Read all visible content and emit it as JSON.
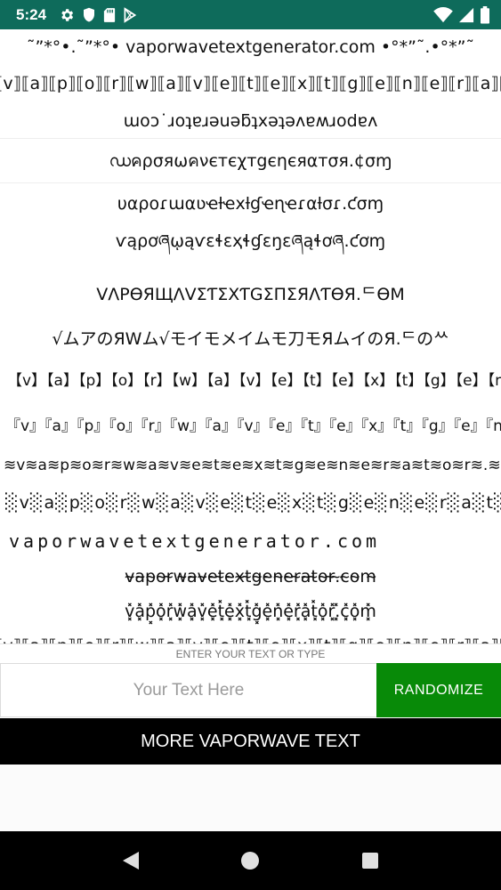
{
  "status_bar": {
    "time": "5:24",
    "left_icons": [
      "gear-icon",
      "shield-icon",
      "sd-card-icon",
      "play-store-icon"
    ],
    "right_icons": [
      "wifi-icon",
      "signal-icon",
      "battery-icon"
    ],
    "background": "#0e6b5b"
  },
  "text_list": [
    "˜”*°•.˜”*°• vaporwavetextgenerator.com •°*”˜.•°*”˜",
    "⟦v⟧⟦a⟧⟦p⟧⟦o⟧⟦r⟧⟦w⟧⟦a⟧⟦v⟧⟦e⟧⟦t⟧⟦e⟧⟦x⟧⟦t⟧⟦g⟧⟦e⟧⟦n⟧⟦e⟧⟦r⟧⟦a⟧⟦t⟧⟦o⟧⟦r⟧.⟦c⟧⟦o⟧⟦m⟧",
    "ɯoɔ˙ɹoʇɐɹǝuǝƃʇxǝʇǝʌɐʍɹodɐʌ",
    "ഡคρσяωคνєтєχтgєηєяαтσя.¢σɱ",
    "υαροɾɯαʋҽƚҽxƚɠҽɳҽɾαƚσɾ.ƈσɱ",
    "ѵąρơཞῳąѵɛɬɛҳɬɠɛŋɛཞąɬơཞ.ƈơɱ",
    "VΛPӨЯЩΛVΣƬΣXƬGΣПΣЯΛƬӨЯ.ᄃӨM",
    "√ムアのЯWム√モイモメイムモ刀モЯムイのЯ.ᄃのᄊ",
    "【v】【a】【p】【o】【r】【w】【a】【v】【e】【t】【e】【x】【t】【g】【e】【n】",
    "『v』『a』『p』『o』『r』『w』『a』『v』『e』『t』『e』『x』『t』『g』『e』『n』",
    "≋v≋a≋p≋o≋r≋w≋a≋v≋e≋t≋e≋x≋t≋g≋e≋n≋e≋r≋a≋t≋o≋r≋.≋c≋o≋m≋",
    "░v░a░p░o░r░w░a░v░e░t░e░x░t░g░e░n░e░r░a░t░o░r░.░c░o░m░",
    "vaporwavetextgenerator.com",
    "v̴a̴p̴o̴r̴w̴a̴v̴e̴t̴e̴x̴t̴g̴e̴n̴e̴r̴a̴t̴o̴r̴.̴c̴o̴m̴",
    "v͓̽a͓̽p͓̽o͓̽r͓̽w͓̽a͓̽v͓̽e͓̽t͓̽e͓̽x͓̽t͓̽g͓̽e͓̽n͓̽e͓̽r͓̽a͓̽t͓̽o͓̽r͓̽.͓̽c͓̽o͓̽m͓̽",
    "⟦v⟧⟦a⟧⟦p⟧⟦o⟧⟦r⟧⟦w⟧⟦a⟧⟦v⟧⟦e⟧⟦t⟧⟦e⟧⟦x⟧⟦t⟧⟦g⟧⟦e⟧⟦n⟧⟦e⟧⟦r⟧⟦a⟧⟦t⟧⟦o⟧⟦r⟧.⟦c⟧⟦o⟧⟦m⟧"
  ],
  "input": {
    "label": "ENTER YOUR TEXT OR TYPE",
    "placeholder": "Your Text Here",
    "value": ""
  },
  "randomize_button": {
    "label": "RANDOMIZE",
    "color": "#088a08"
  },
  "more_button": {
    "label": "MORE VAPORWAVE TEXT"
  },
  "nav_bar": {
    "icons": [
      "back-icon",
      "home-icon",
      "recents-icon"
    ]
  }
}
